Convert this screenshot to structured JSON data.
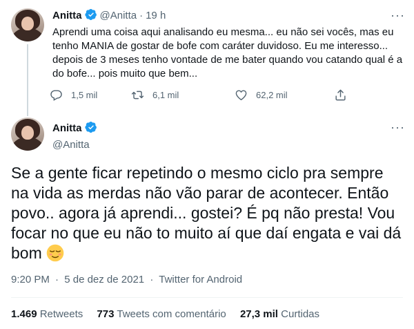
{
  "colors": {
    "text": "#0f1419",
    "muted": "#536471",
    "verified": "#1d9bf0",
    "divider": "#eff3f4",
    "thread_line": "#cfd9de"
  },
  "tweet1": {
    "name": "Anitta",
    "handle": "@Anitta",
    "separator": "·",
    "time": "19 h",
    "text": "Aprendi uma coisa aqui analisando eu mesma... eu não sei vocês, mas eu tenho MANIA de gostar de bofe com caráter duvidoso. Eu me interesso... depois de 3 meses tenho vontade de me bater quando vou catando qual é a do bofe... pois muito que bem...",
    "actions": {
      "replies": "1,5 mil",
      "retweets": "6,1 mil",
      "likes": "62,2 mil"
    }
  },
  "tweet2": {
    "name": "Anitta",
    "handle": "@Anitta",
    "text": "Se a gente ficar repetindo o mesmo ciclo pra sempre na vida as merdas não vão parar de acontecer. Então povo.. agora já aprendi... gostei? É pq não presta! Vou focar no que eu não to muito aí que daí engata e vai dá bom",
    "emoji": "relieved-face",
    "time": "9:20 PM",
    "separator": "·",
    "date": "5 de dez de 2021",
    "source": "Twitter for Android",
    "stats": {
      "retweets_value": "1.469",
      "retweets_label": "Retweets",
      "quotes_value": "773",
      "quotes_label": "Tweets com comentário",
      "likes_value": "27,3 mil",
      "likes_label": "Curtidas"
    }
  }
}
